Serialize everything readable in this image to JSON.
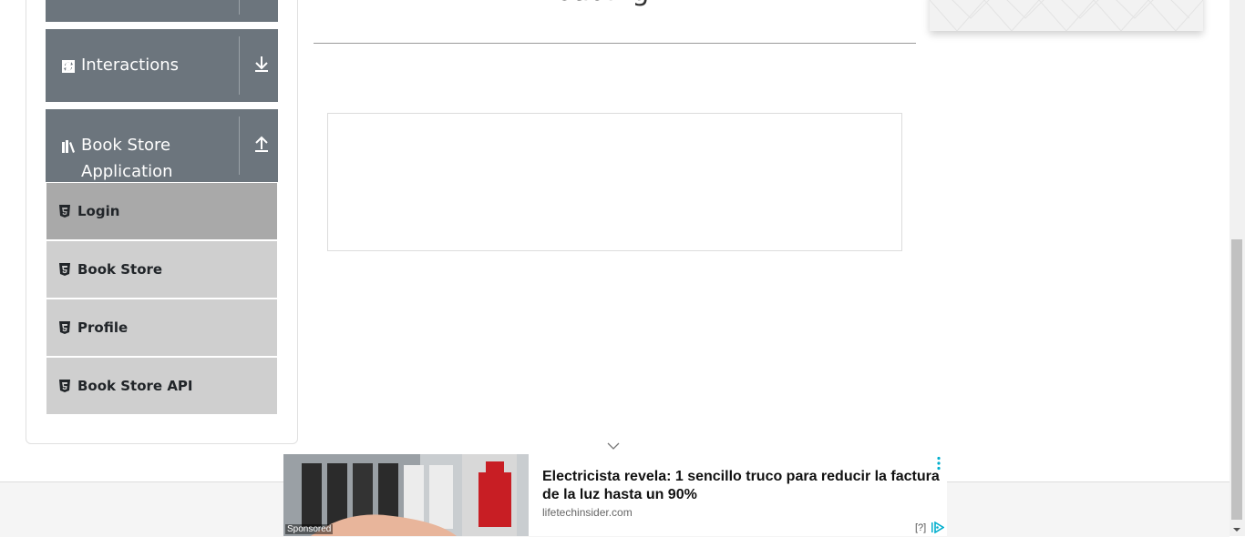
{
  "main": {
    "loading_text": "Loading..."
  },
  "sidebar": {
    "groups": [
      {
        "label": "Interactions",
        "icon": "refresh-icon"
      },
      {
        "label_line1": "Book Store",
        "label_line2": "Application",
        "icon": "books-icon"
      }
    ],
    "items": [
      {
        "label": "Login",
        "active": true
      },
      {
        "label": "Book Store"
      },
      {
        "label": "Profile"
      },
      {
        "label": "Book Store API"
      }
    ]
  },
  "ad": {
    "sponsored": "Sponsored",
    "title": "Electricista revela: 1 sencillo truco para reducir la factura de la luz hasta un 90%",
    "domain": "lifetechinsider.com",
    "adchoices_q": "[?]"
  },
  "colors": {
    "group_header_bg": "#6c757d",
    "menu_item_bg": "#cfcfcf",
    "menu_item_active_bg": "#a9a9a9",
    "adchoices": "#00aecd"
  }
}
